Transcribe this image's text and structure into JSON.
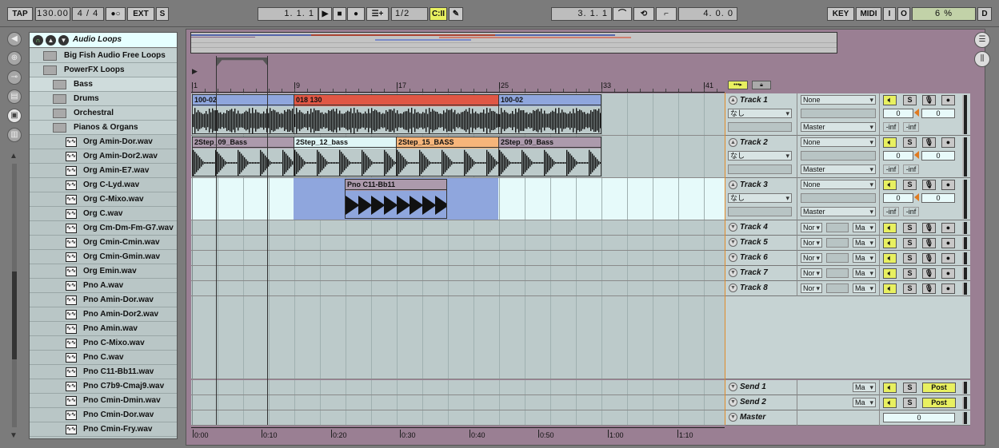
{
  "transport": {
    "tap": "TAP",
    "tempo": "130.00",
    "signature": "4 / 4",
    "ext": "EXT",
    "s": "S",
    "position": "1.  1.  1",
    "quantize": "1/2",
    "loop_start": "3.  1.  1",
    "loop_length": "4.  0.  0",
    "key": "KEY",
    "midi": "MIDI",
    "i": "I",
    "o": "O",
    "cpu": "6 %",
    "d": "D"
  },
  "browser": {
    "title": "Audio Loops",
    "items": [
      {
        "label": "Big Fish Audio Free Loops",
        "type": "folder",
        "level": 0
      },
      {
        "label": "PowerFX Loops",
        "type": "folder",
        "level": 0
      },
      {
        "label": "Bass",
        "type": "folder",
        "level": 1
      },
      {
        "label": "Drums",
        "type": "folder",
        "level": 1
      },
      {
        "label": "Orchestral",
        "type": "folder",
        "level": 1
      },
      {
        "label": "Pianos & Organs",
        "type": "folder",
        "level": 1
      },
      {
        "label": "Org Amin-Dor.wav",
        "type": "file"
      },
      {
        "label": "Org Amin-Dor2.wav",
        "type": "file"
      },
      {
        "label": "Org Amin-E7.wav",
        "type": "file"
      },
      {
        "label": "Org C-Lyd.wav",
        "type": "file"
      },
      {
        "label": "Org C-Mixo.wav",
        "type": "file"
      },
      {
        "label": "Org C.wav",
        "type": "file"
      },
      {
        "label": "Org Cm-Dm-Fm-G7.wav",
        "type": "file"
      },
      {
        "label": "Org Cmin-Cmin.wav",
        "type": "file"
      },
      {
        "label": "Org Cmin-Gmin.wav",
        "type": "file"
      },
      {
        "label": "Org Emin.wav",
        "type": "file"
      },
      {
        "label": "Pno A.wav",
        "type": "file"
      },
      {
        "label": "Pno Amin-Dor.wav",
        "type": "file"
      },
      {
        "label": "Pno Amin-Dor2.wav",
        "type": "file"
      },
      {
        "label": "Pno Amin.wav",
        "type": "file"
      },
      {
        "label": "Pno C-Mixo.wav",
        "type": "file"
      },
      {
        "label": "Pno C.wav",
        "type": "file"
      },
      {
        "label": "Pno C11-Bb11.wav",
        "type": "file"
      },
      {
        "label": "Pno C7b9-Cmaj9.wav",
        "type": "file"
      },
      {
        "label": "Pno Cmin-Dmin.wav",
        "type": "file"
      },
      {
        "label": "Pno Cmin-Dor.wav",
        "type": "file"
      },
      {
        "label": "Pno Cmin-Fry.wav",
        "type": "file"
      }
    ]
  },
  "ruler": {
    "bars": [
      "1",
      "9",
      "17",
      "25",
      "33",
      "41"
    ],
    "times": [
      "0:00",
      "0:10",
      "0:20",
      "0:30",
      "0:40",
      "0:50",
      "1:00",
      "1:10"
    ]
  },
  "clips": {
    "t1": [
      {
        "name": "100-02",
        "color": "#8fa6dd"
      },
      {
        "name": "018 130",
        "color": "#e05745"
      },
      {
        "name": "100-02",
        "color": "#8fa6dd"
      }
    ],
    "t2": [
      {
        "name": "2Step_09_Bass",
        "color": "#ac9aac"
      },
      {
        "name": "2Step_12_bass",
        "color": "#dff6f6"
      },
      {
        "name": "2Step_15_BASS",
        "color": "#f6b57a"
      },
      {
        "name": "2Step_09_Bass",
        "color": "#ac9aac"
      }
    ],
    "t3": [
      {
        "name": "Pno C11-Bb11",
        "color": "#ac9aac"
      }
    ]
  },
  "tracks": [
    {
      "name": "Track 1",
      "input": "None",
      "sub": "なし",
      "output": "Master",
      "vol": "0",
      "pan": "0",
      "inf1": "-inf",
      "inf2": "-inf"
    },
    {
      "name": "Track 2",
      "input": "None",
      "sub": "なし",
      "output": "Master",
      "vol": "0",
      "pan": "0",
      "inf1": "-inf",
      "inf2": "-inf"
    },
    {
      "name": "Track 3",
      "input": "None",
      "sub": "なし",
      "output": "Master",
      "vol": "0",
      "pan": "0",
      "inf1": "-inf",
      "inf2": "-inf"
    },
    {
      "name": "Track 4",
      "input": "Nor",
      "output": "Ma"
    },
    {
      "name": "Track 5",
      "input": "Nor",
      "output": "Ma"
    },
    {
      "name": "Track 6",
      "input": "Nor",
      "output": "Ma"
    },
    {
      "name": "Track 7",
      "input": "Nor",
      "output": "Ma"
    },
    {
      "name": "Track 8",
      "input": "Nor",
      "output": "Ma"
    }
  ],
  "sends": [
    {
      "name": "Send 1",
      "output": "Ma",
      "post": "Post"
    },
    {
      "name": "Send 2",
      "output": "Ma",
      "post": "Post"
    }
  ],
  "master": {
    "name": "Master",
    "vol": "0"
  },
  "mixer_labels": {
    "solo": "S"
  },
  "colors": {
    "accent_yellow": "#e8f060",
    "arm_red": "#222",
    "clip_blue": "#8fa6dd",
    "clip_red": "#e05745",
    "clip_orange": "#f6b57a",
    "clip_mauve": "#ac9aac"
  }
}
